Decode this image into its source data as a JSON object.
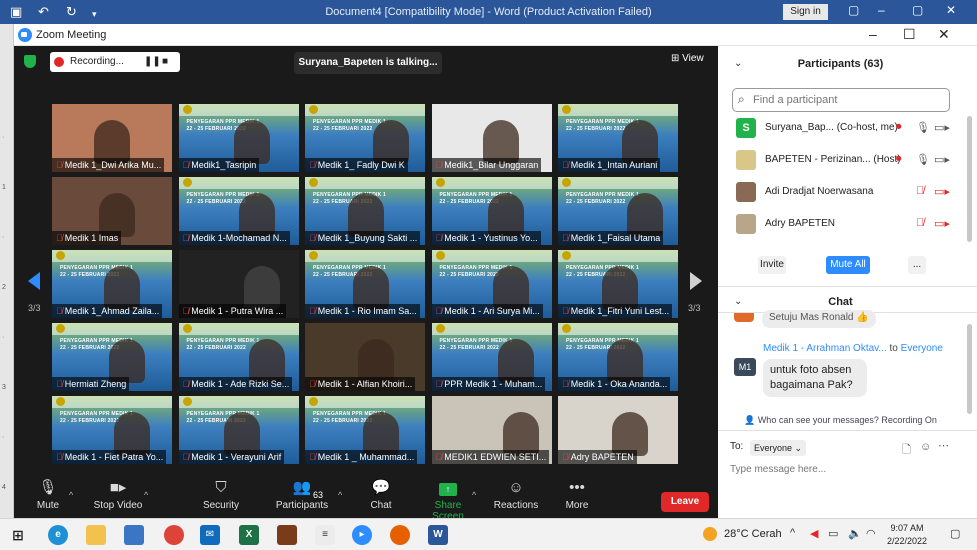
{
  "word": {
    "title": "Document4 [Compatibility Mode]  -  Word (Product Activation Failed)",
    "signin": "Sign in"
  },
  "zoom_window": {
    "title": "Zoom Meeting"
  },
  "meeting": {
    "recording_label": "Recording...",
    "talking": "Suryana_Bapeten is talking...",
    "view_label": "View",
    "page_left": "3/3",
    "page_right": "3/3",
    "banner_text": "PENYEGARAN PPR MEDIK 1",
    "banner_date": "22 - 25 FEBRUARI 2022",
    "tiles": [
      {
        "name": "Medik 1_Dwi Arika Mu...",
        "kind": "person",
        "bg": "#b87a5a"
      },
      {
        "name": "Medik1_Tasripin",
        "kind": "banner",
        "bg": "#2f6fb3"
      },
      {
        "name": "Medik 1_ Fadly Dwi K",
        "kind": "banner",
        "bg": "#2f6fb3"
      },
      {
        "name": "Medik1_Bilar Unggaran",
        "kind": "person",
        "bg": "#e8e8e8"
      },
      {
        "name": "Medik 1_Intan Auriani",
        "kind": "banner",
        "bg": "#2f6fb3"
      },
      {
        "name": "Medik 1 Imas",
        "kind": "person",
        "bg": "#6a4a3a"
      },
      {
        "name": "Medik 1-Mochamad N...",
        "kind": "banner",
        "bg": "#2f6fb3"
      },
      {
        "name": "Medik 1_Buyung Sakti ...",
        "kind": "banner",
        "bg": "#2f6fb3"
      },
      {
        "name": "Medik 1 - Yustinus Yo...",
        "kind": "banner",
        "bg": "#4a7fc4"
      },
      {
        "name": "Medik 1_Faisal Utama",
        "kind": "banner",
        "bg": "#2f6fb3"
      },
      {
        "name": "Medik 1_Ahmad Zaila...",
        "kind": "banner",
        "bg": "#2f6fb3"
      },
      {
        "name": "Medik 1 - Putra Wira ...",
        "kind": "dark",
        "bg": "#222222"
      },
      {
        "name": "Medik 1 - Rio Imam Sa...",
        "kind": "banner",
        "bg": "#2a5d9a"
      },
      {
        "name": "Medik 1 - Ari Surya Mi...",
        "kind": "banner",
        "bg": "#2f6fb3"
      },
      {
        "name": "Medik 1_Fitri Yuni Lest...",
        "kind": "banner",
        "bg": "#2f6fb3"
      },
      {
        "name": "Hermiati Zheng",
        "kind": "banner",
        "bg": "#2f6fb3"
      },
      {
        "name": "Medik 1 - Ade Rizki Se...",
        "kind": "banner",
        "bg": "#2f6fb3"
      },
      {
        "name": "Medik 1 - Alfian Khoiri...",
        "kind": "person",
        "bg": "#4a3a2a"
      },
      {
        "name": "PPR Medik 1 - Muham...",
        "kind": "banner",
        "bg": "#1f7fbf"
      },
      {
        "name": "Medik 1 - Oka Ananda...",
        "kind": "banner",
        "bg": "#2f6fb3"
      },
      {
        "name": "Medik 1 - Fiet Patra Yo...",
        "kind": "banner",
        "bg": "#2f6fb3"
      },
      {
        "name": "Medik 1 - Verayuni Arif",
        "kind": "banner",
        "bg": "#2f6fb3"
      },
      {
        "name": "Medik 1 _ Muhammad...",
        "kind": "banner",
        "bg": "#2f6fb3"
      },
      {
        "name": "MEDIK1 EDWIEN SETI...",
        "kind": "person",
        "bg": "#c9c3b8"
      },
      {
        "name": "Adry BAPETEN",
        "kind": "person",
        "bg": "#d8d4cc"
      }
    ]
  },
  "toolbar": {
    "mute": "Mute",
    "stop_video": "Stop Video",
    "security": "Security",
    "participants": "Participants",
    "participants_count": "63",
    "chat": "Chat",
    "share_screen": "Share Screen",
    "reactions": "Reactions",
    "more": "More",
    "leave": "Leave"
  },
  "panel": {
    "participants_title": "Participants (63)",
    "search_placeholder": "Find a participant",
    "participants": [
      {
        "avatar": "S",
        "avatar_color": "#22b24c",
        "name": "Suryana_Bap... (Co-host, me)"
      },
      {
        "avatar": "",
        "avatar_color": "#d9c78a",
        "name": "BAPETEN - Perizinan... (Host)"
      },
      {
        "avatar": "",
        "avatar_color": "#8a6a55",
        "name": "Adi Dradjat Noerwasana"
      },
      {
        "avatar": "",
        "avatar_color": "#b8a58a",
        "name": "Adry BAPETEN"
      }
    ],
    "invite": "Invite",
    "mute_all": "Mute All",
    "more": "...",
    "chat_title": "Chat",
    "partial_message": "Setuju Mas Ronald 👍",
    "sender": "Medik 1 - Arrahman Oktav...",
    "to_word": "to",
    "to_target": "Everyone",
    "sender_initials": "M1",
    "message_line1": "untuk foto absen",
    "message_line2": "bagaimana Pak?",
    "notice": "Who can see your messages? Recording On",
    "to_label": "To:",
    "to_value": "Everyone",
    "input_placeholder": "Type message here..."
  },
  "taskbar": {
    "weather": "28°C  Cerah",
    "time": "9:07 AM",
    "date": "2/22/2022"
  },
  "colors": {
    "zoom_blue": "#2d8cff",
    "leave_red": "#e02828",
    "word_blue": "#2b579a",
    "share_green": "#22b24c"
  }
}
